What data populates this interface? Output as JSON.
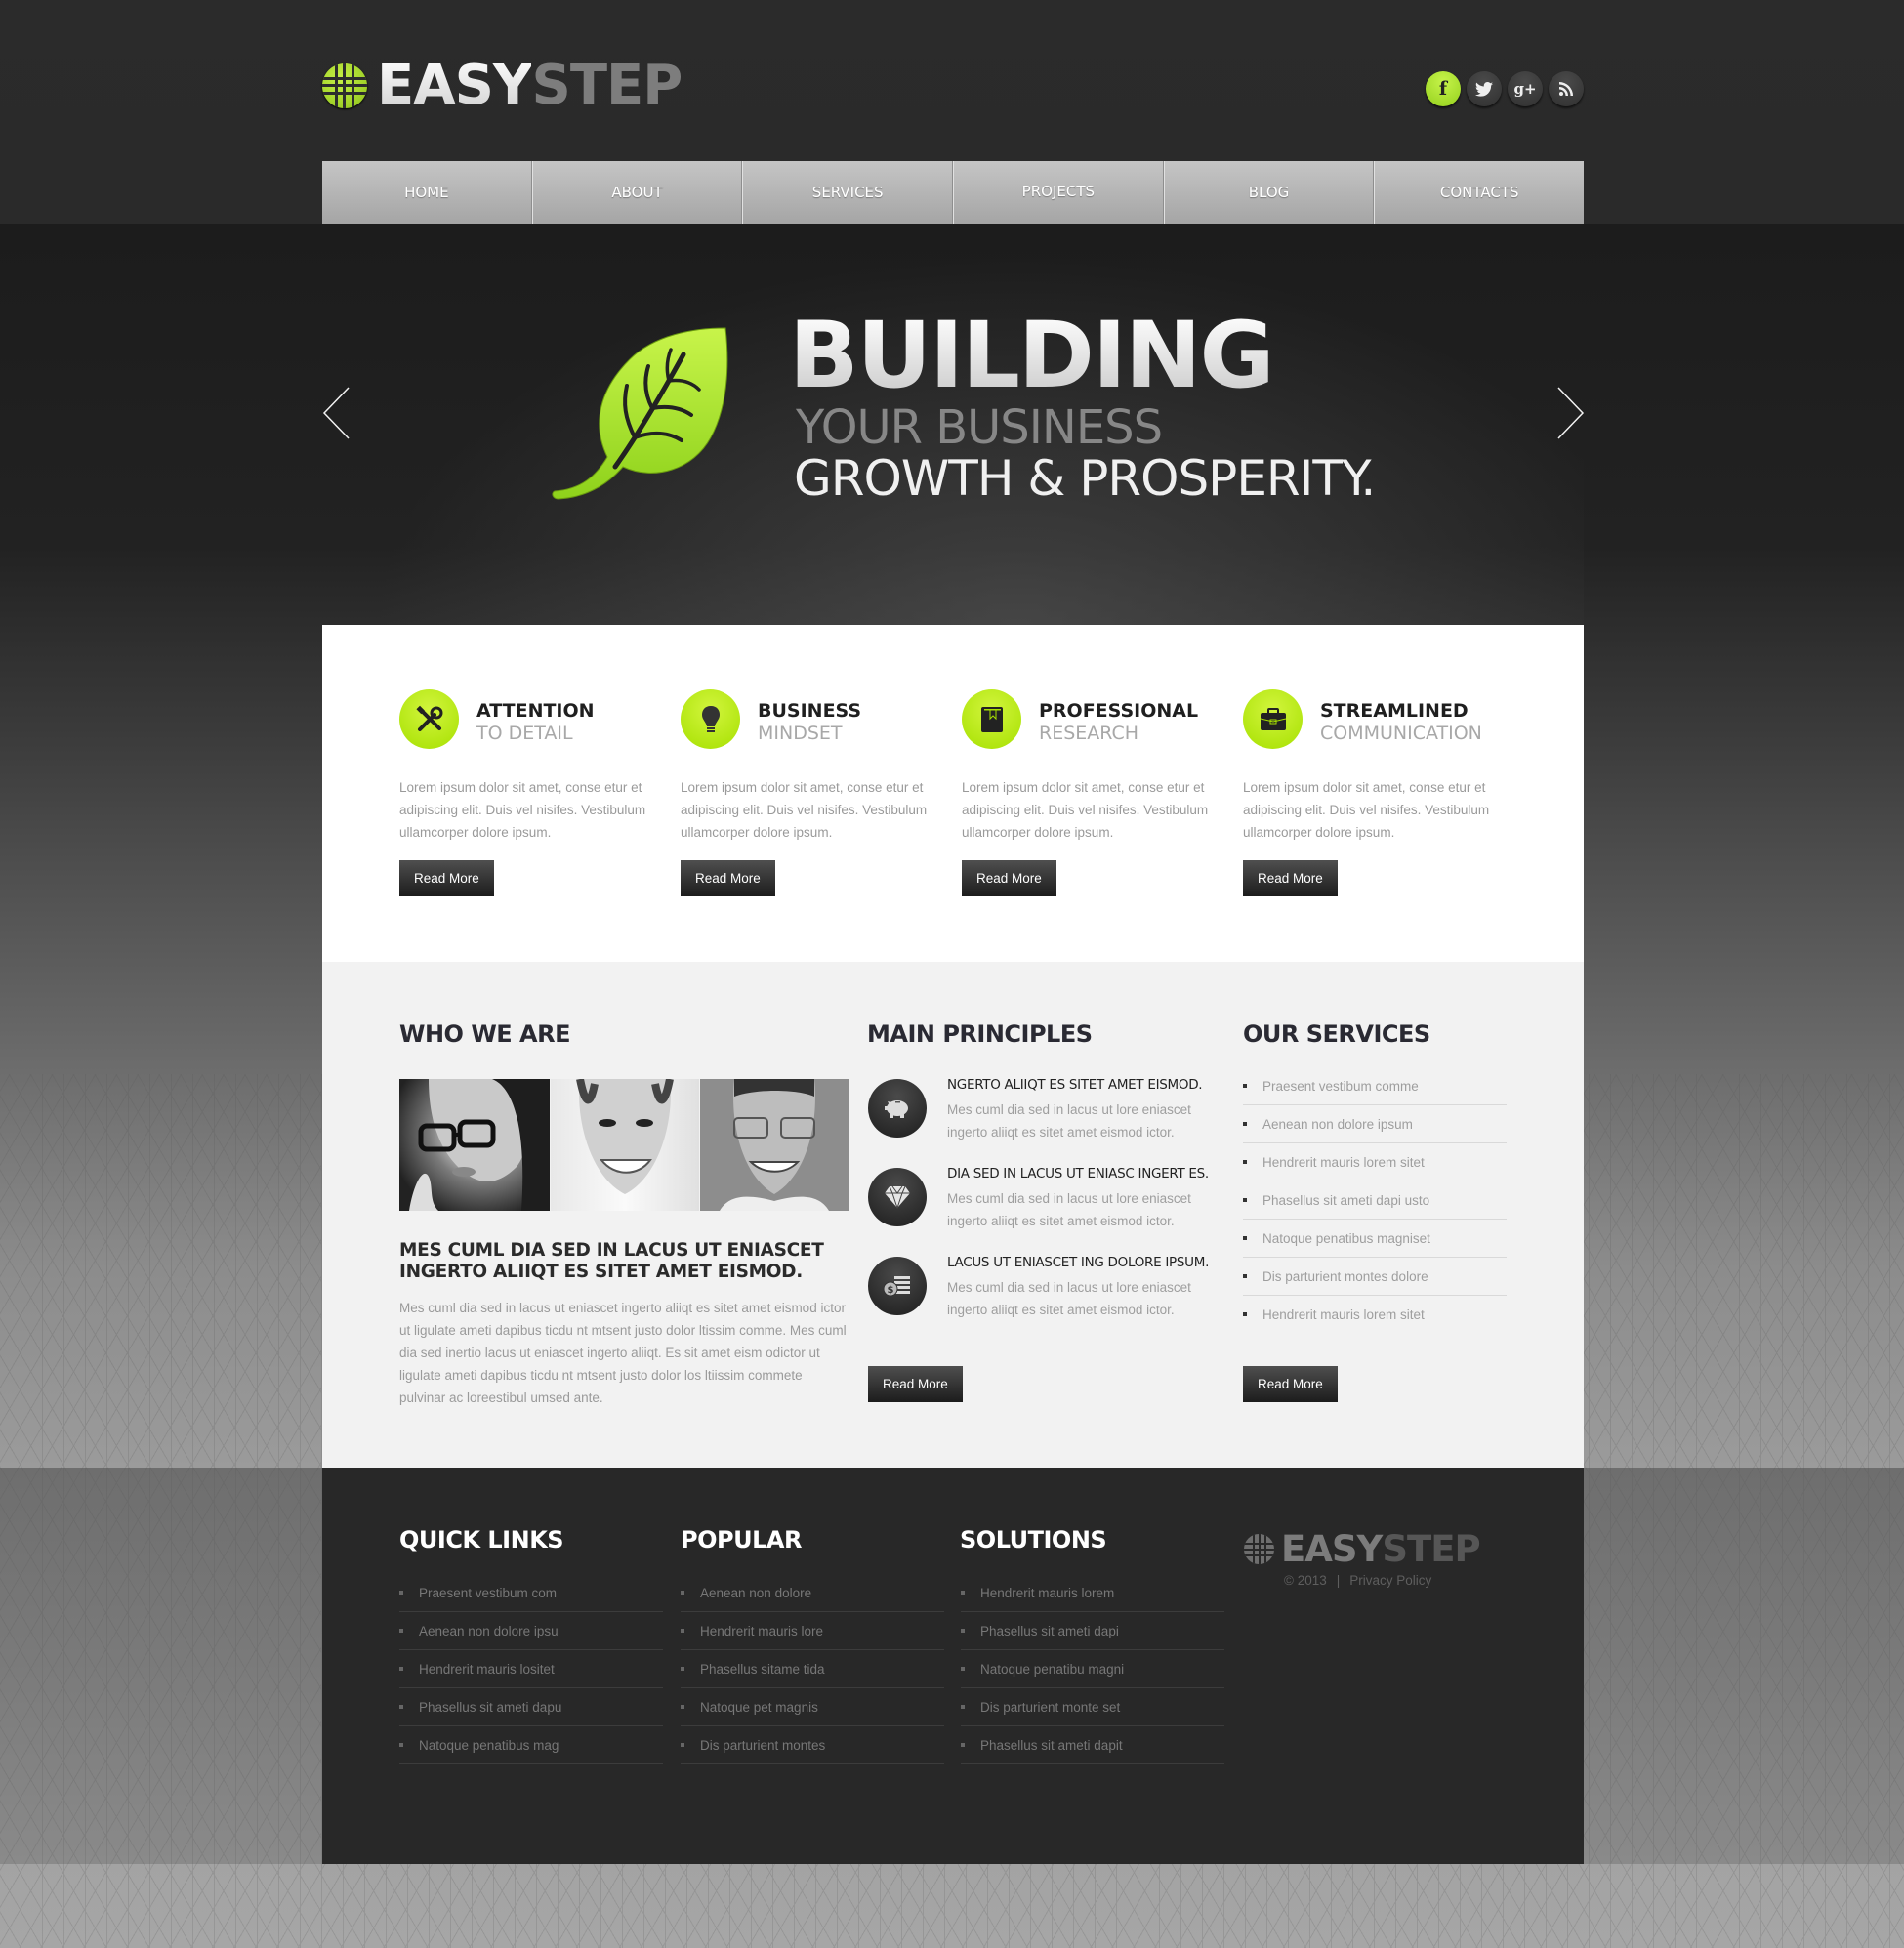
{
  "header": {
    "logo_part1": "EASY",
    "logo_part2": "STEP",
    "social": [
      {
        "icon": "facebook-icon",
        "glyph": "f"
      },
      {
        "icon": "twitter-icon",
        "glyph": "🐦"
      },
      {
        "icon": "google-plus-icon",
        "glyph": "g+"
      },
      {
        "icon": "rss-icon",
        "glyph": "◝"
      }
    ],
    "accent_color": "#a6e000"
  },
  "nav": {
    "items": [
      "HOME",
      "ABOUT",
      "SERVICES",
      "PROJECTS",
      "BLOG",
      "CONTACTS"
    ]
  },
  "hero": {
    "line1": "BUILDING",
    "line2": "YOUR BUSINESS",
    "line3": "GROWTH & PROSPERITY.",
    "prev_icon": "chevron-left-icon",
    "next_icon": "chevron-right-icon"
  },
  "features": [
    {
      "title": "ATTENTION",
      "subtitle": "TO DETAIL",
      "icon": "tools-icon",
      "text": "Lorem ipsum dolor sit amet, conse etur et adipiscing elit. Duis vel nisifes. Vestibulum ullamcorper dolore ipsum.",
      "button": "Read More"
    },
    {
      "title": "BUSINESS",
      "subtitle": "MINDSET",
      "icon": "lightbulb-icon",
      "text": "Lorem ipsum dolor sit amet, conse etur et adipiscing elit. Duis vel nisifes. Vestibulum ullamcorper dolore ipsum.",
      "button": "Read More"
    },
    {
      "title": "PROFESSIONAL",
      "subtitle": "RESEARCH",
      "icon": "book-icon",
      "text": "Lorem ipsum dolor sit amet, conse etur et adipiscing elit. Duis vel nisifes. Vestibulum ullamcorper dolore ipsum.",
      "button": "Read More"
    },
    {
      "title": "STREAMLINED",
      "subtitle": "COMMUNICATION",
      "icon": "briefcase-icon",
      "text": "Lorem ipsum dolor sit amet, conse etur et adipiscing elit. Duis vel nisifes. Vestibulum ullamcorper dolore ipsum.",
      "button": "Read More"
    }
  ],
  "who": {
    "title": "WHO WE ARE",
    "heading": "MES CUML DIA SED IN LACUS UT ENIASCET INGERTO ALIIQT ES SITET AMET EISMOD.",
    "text": "Mes cuml dia sed in lacus ut eniascet ingerto aliiqt es sitet amet eismod ictor ut ligulate ameti dapibus ticdu nt mtsent justo dolor ltissim comme. Mes cuml dia sed inertio lacus ut eniascet ingerto aliiqt. Es sit amet eism odictor ut ligulate ameti dapibus ticdu nt mtsent justo dolor los ltiissim commete pulvinar ac loreestibul umsed ante."
  },
  "principles": {
    "title": "MAIN PRINCIPLES",
    "items": [
      {
        "icon": "piggy-bank-icon",
        "title": "NGERTO ALIIQT ES SITET AMET EISMOD.",
        "text": "Mes cuml dia sed in lacus ut lore eniascet ingerto aliiqt es sitet amet eismod ictor."
      },
      {
        "icon": "diamond-icon",
        "title": "DIA SED IN LACUS UT ENIASC INGERT ES.",
        "text": "Mes cuml dia sed in lacus ut lore eniascet ingerto aliiqt es sitet amet eismod ictor."
      },
      {
        "icon": "coins-icon",
        "title": "LACUS UT ENIASCET ING DOLORE IPSUM.",
        "text": "Mes cuml dia sed in lacus ut lore eniascet ingerto aliiqt es sitet amet eismod ictor."
      }
    ],
    "button": "Read More"
  },
  "services": {
    "title": "OUR SERVICES",
    "items": [
      "Praesent vestibum comme",
      "Aenean non dolore ipsum",
      "Hendrerit mauris lorem sitet",
      "Phasellus sit ameti dapi usto",
      "Natoque penatibus magniset",
      "Dis parturient montes dolore",
      "Hendrerit mauris lorem sitet"
    ],
    "button": "Read More"
  },
  "footer": {
    "columns": [
      {
        "title": "QUICK LINKS",
        "items": [
          "Praesent vestibum com",
          "Aenean non dolore ipsu",
          "Hendrerit mauris lositet",
          "Phasellus sit ameti dapu",
          "Natoque penatibus mag"
        ]
      },
      {
        "title": "POPULAR",
        "items": [
          "Aenean non dolore",
          "Hendrerit mauris lore",
          "Phasellus sitame tida",
          "Natoque pet magnis",
          "Dis parturient montes"
        ]
      },
      {
        "title": "SOLUTIONS",
        "items": [
          "Hendrerit mauris lorem",
          "Phasellus sit ameti dapi",
          "Natoque penatibu magni",
          "Dis parturient monte set",
          "Phasellus sit ameti dapit"
        ]
      }
    ],
    "logo_part1": "EASY",
    "logo_part2": "STEP",
    "copyright": "© 2013",
    "separator": "|",
    "privacy": "Privacy Policy"
  }
}
